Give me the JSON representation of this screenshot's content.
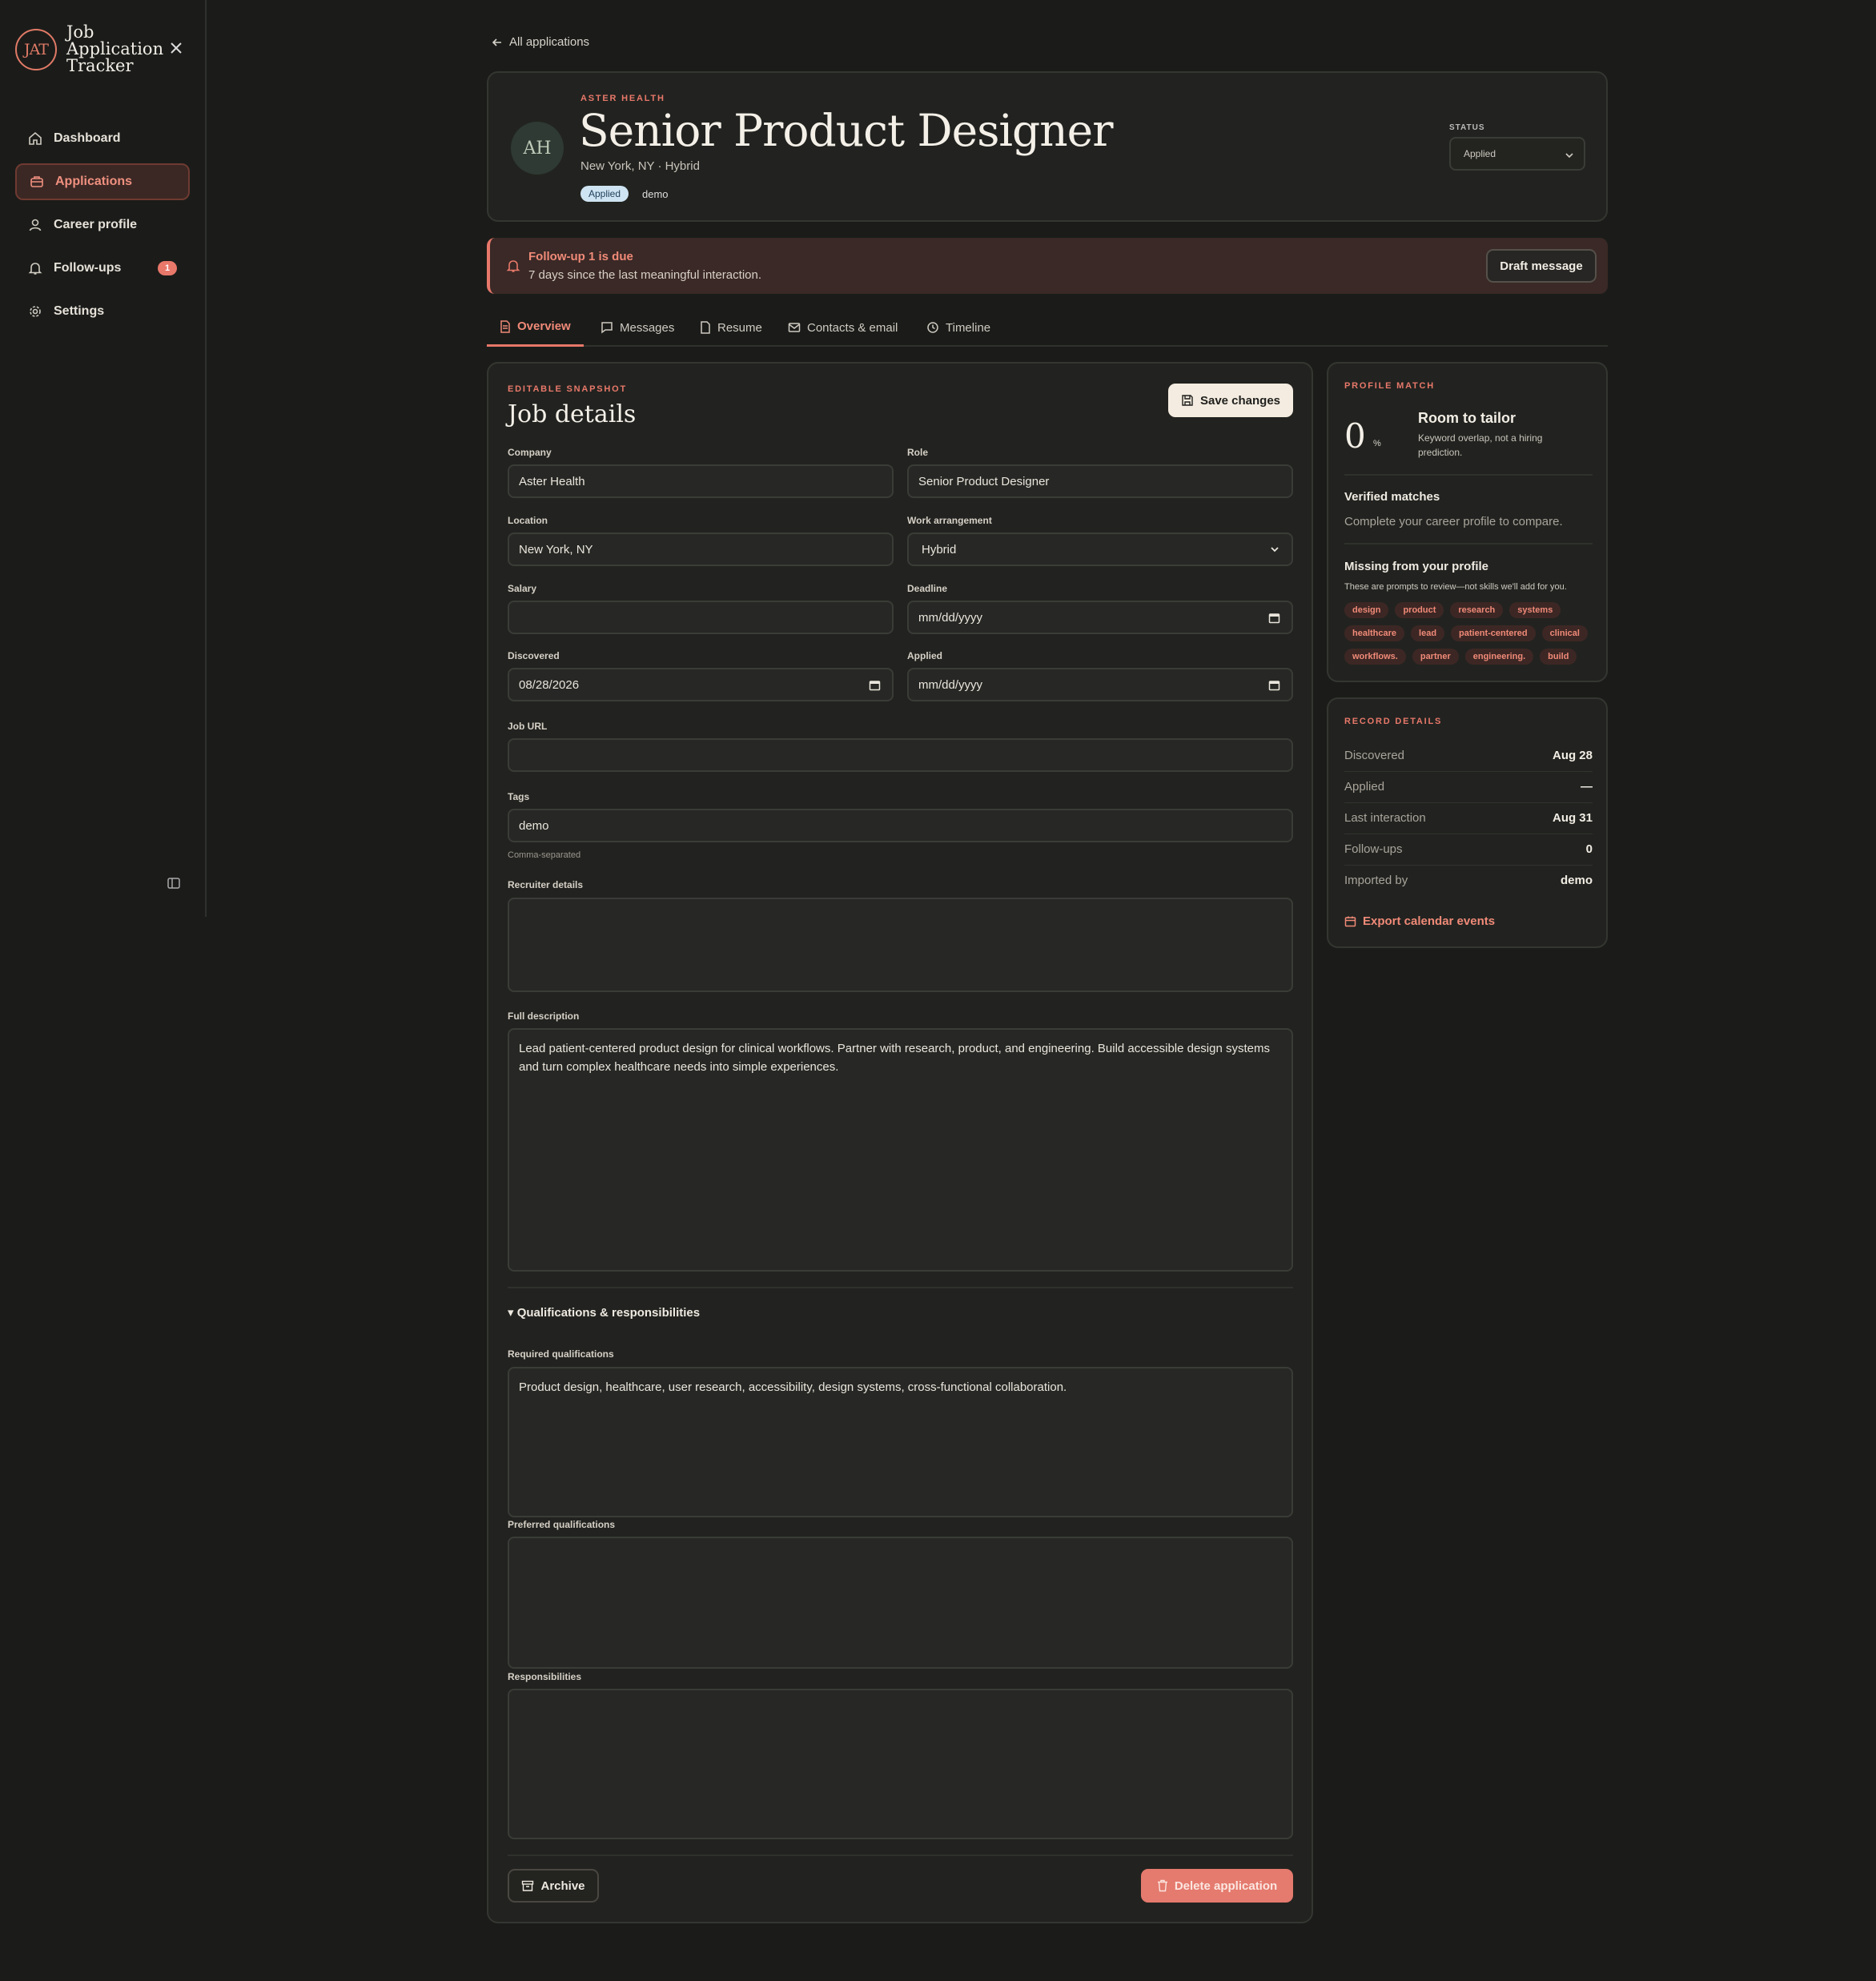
{
  "sidebar": {
    "logo_text": "JAT",
    "app_name": "Job Application Tracker",
    "items": [
      {
        "label": "Dashboard",
        "icon": "home-icon"
      },
      {
        "label": "Applications",
        "icon": "briefcase-icon",
        "active": true
      },
      {
        "label": "Career profile",
        "icon": "user-icon"
      },
      {
        "label": "Follow-ups",
        "icon": "bell-icon",
        "badge": "1"
      },
      {
        "label": "Settings",
        "icon": "gear-icon"
      }
    ]
  },
  "back_link": "All applications",
  "header": {
    "avatar": "AH",
    "company": "ASTER HEALTH",
    "title": "Senior Product Designer",
    "location_line": "New York, NY · Hybrid",
    "status_pill": "Applied",
    "tag": "demo",
    "status_label": "STATUS",
    "status_value": "Applied"
  },
  "alert": {
    "title": "Follow-up 1 is due",
    "subtitle": "7 days since the last meaningful interaction.",
    "button": "Draft message"
  },
  "tabs": [
    "Overview",
    "Messages",
    "Resume",
    "Contacts & email",
    "Timeline"
  ],
  "details": {
    "eyebrow": "EDITABLE SNAPSHOT",
    "title": "Job details",
    "save_label": "Save changes",
    "labels": {
      "company": "Company",
      "role": "Role",
      "location": "Location",
      "work": "Work arrangement",
      "salary": "Salary",
      "deadline": "Deadline",
      "discovered": "Discovered",
      "applied": "Applied",
      "job_url": "Job URL",
      "tags": "Tags",
      "recruiter": "Recruiter details",
      "description": "Full description",
      "required": "Required qualifications",
      "preferred": "Preferred qualifications",
      "responsibilities": "Responsibilities"
    },
    "values": {
      "company": "Aster Health",
      "role": "Senior Product Designer",
      "location": "New York, NY",
      "work": "Hybrid",
      "salary": "",
      "deadline": "mm/dd/yyyy",
      "discovered": "08/28/2026",
      "applied": "mm/dd/yyyy",
      "job_url": "",
      "tags": "demo",
      "recruiter": "",
      "description": "Lead patient-centered product design for clinical workflows. Partner with research, product, and engineering. Build accessible design systems and turn complex healthcare needs into simple experiences.",
      "required": "Product design, healthcare, user research, accessibility, design systems, cross-functional collaboration.",
      "preferred": "",
      "responsibilities": ""
    },
    "tags_hint": "Comma-separated",
    "qual_toggle": "▾ Qualifications & responsibilities",
    "archive_label": "Archive",
    "delete_label": "Delete application"
  },
  "profile_match": {
    "eyebrow": "PROFILE MATCH",
    "score": "0",
    "score_unit": "%",
    "title": "Room to tailor",
    "subtitle": "Keyword overlap, not a hiring prediction.",
    "verified_title": "Verified matches",
    "verified_text": "Complete your career profile to compare.",
    "missing_title": "Missing from your profile",
    "missing_text": "These are prompts to review—not skills we'll add for you.",
    "chips": [
      "design",
      "product",
      "research",
      "systems",
      "healthcare",
      "lead",
      "patient-centered",
      "clinical",
      "workflows.",
      "partner",
      "engineering.",
      "build"
    ]
  },
  "record": {
    "eyebrow": "RECORD DETAILS",
    "rows": [
      {
        "k": "Discovered",
        "v": "Aug 28"
      },
      {
        "k": "Applied",
        "v": "—"
      },
      {
        "k": "Last interaction",
        "v": "Aug 31"
      },
      {
        "k": "Follow-ups",
        "v": "0"
      },
      {
        "k": "Imported by",
        "v": "demo"
      }
    ],
    "export_label": "Export calendar events"
  },
  "colors": {
    "accent": "#e8786a",
    "background": "#1b1c1a",
    "card": "#222320"
  }
}
